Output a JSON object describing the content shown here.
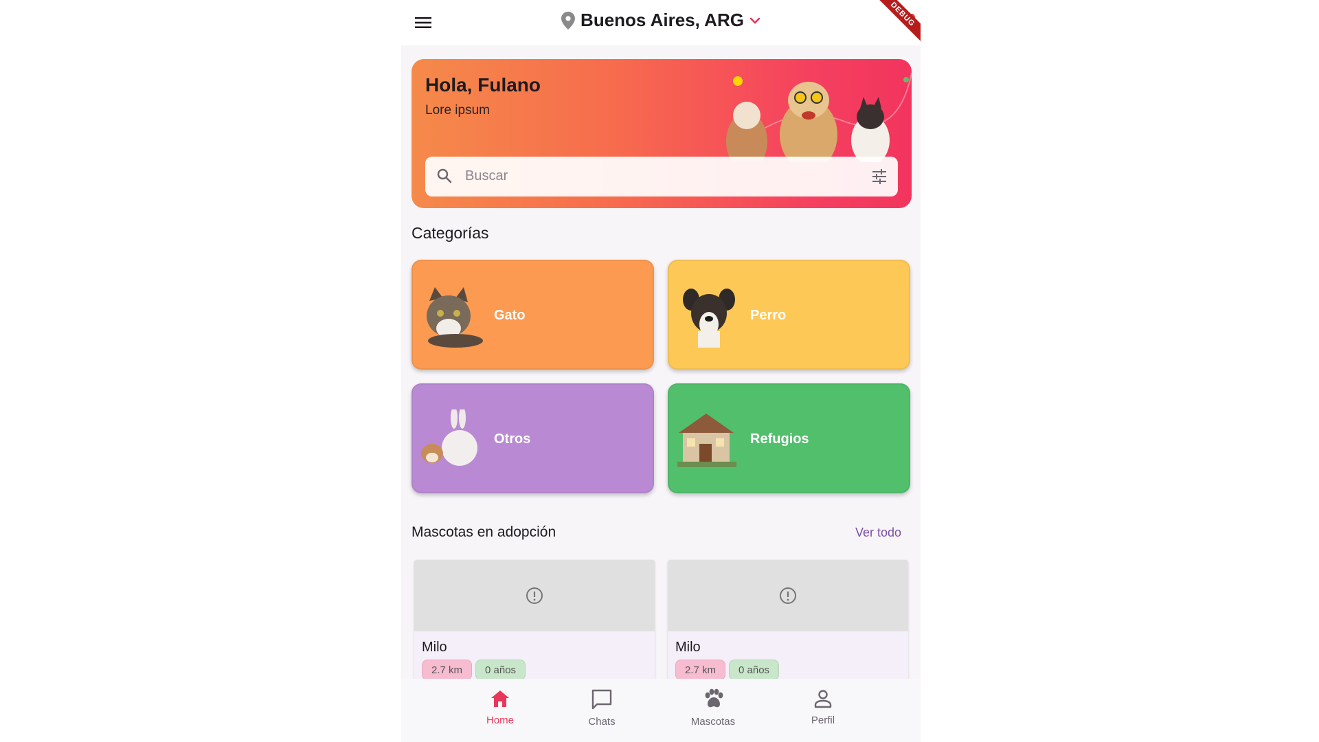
{
  "app_bar": {
    "location": "Buenos Aires, ARG",
    "debug_badge": "DEBUG"
  },
  "hero": {
    "greeting": "Hola, Fulano",
    "subtitle": "Lore ipsum",
    "search_placeholder": "Buscar"
  },
  "categories": {
    "title": "Categorías",
    "items": [
      {
        "label": "Gato",
        "color": "#fb9a50"
      },
      {
        "label": "Perro",
        "color": "#fdc856"
      },
      {
        "label": "Otros",
        "color": "#b98ad3"
      },
      {
        "label": "Refugios",
        "color": "#52bf6c"
      }
    ]
  },
  "adoption": {
    "title": "Mascotas en adopción",
    "see_all": "Ver todo",
    "pets": [
      {
        "name": "Milo",
        "distance": "2.7 km",
        "age": "0 años"
      },
      {
        "name": "Milo",
        "distance": "2.7 km",
        "age": "0 años"
      }
    ]
  },
  "bottom_nav": {
    "items": [
      {
        "label": "Home",
        "icon": "home-icon",
        "active": true
      },
      {
        "label": "Chats",
        "icon": "chat-icon",
        "active": false
      },
      {
        "label": "Mascotas",
        "icon": "paw-icon",
        "active": false
      },
      {
        "label": "Perfil",
        "icon": "person-icon",
        "active": false
      }
    ]
  },
  "colors": {
    "accent": "#e8375a",
    "link": "#7a4fa3"
  }
}
